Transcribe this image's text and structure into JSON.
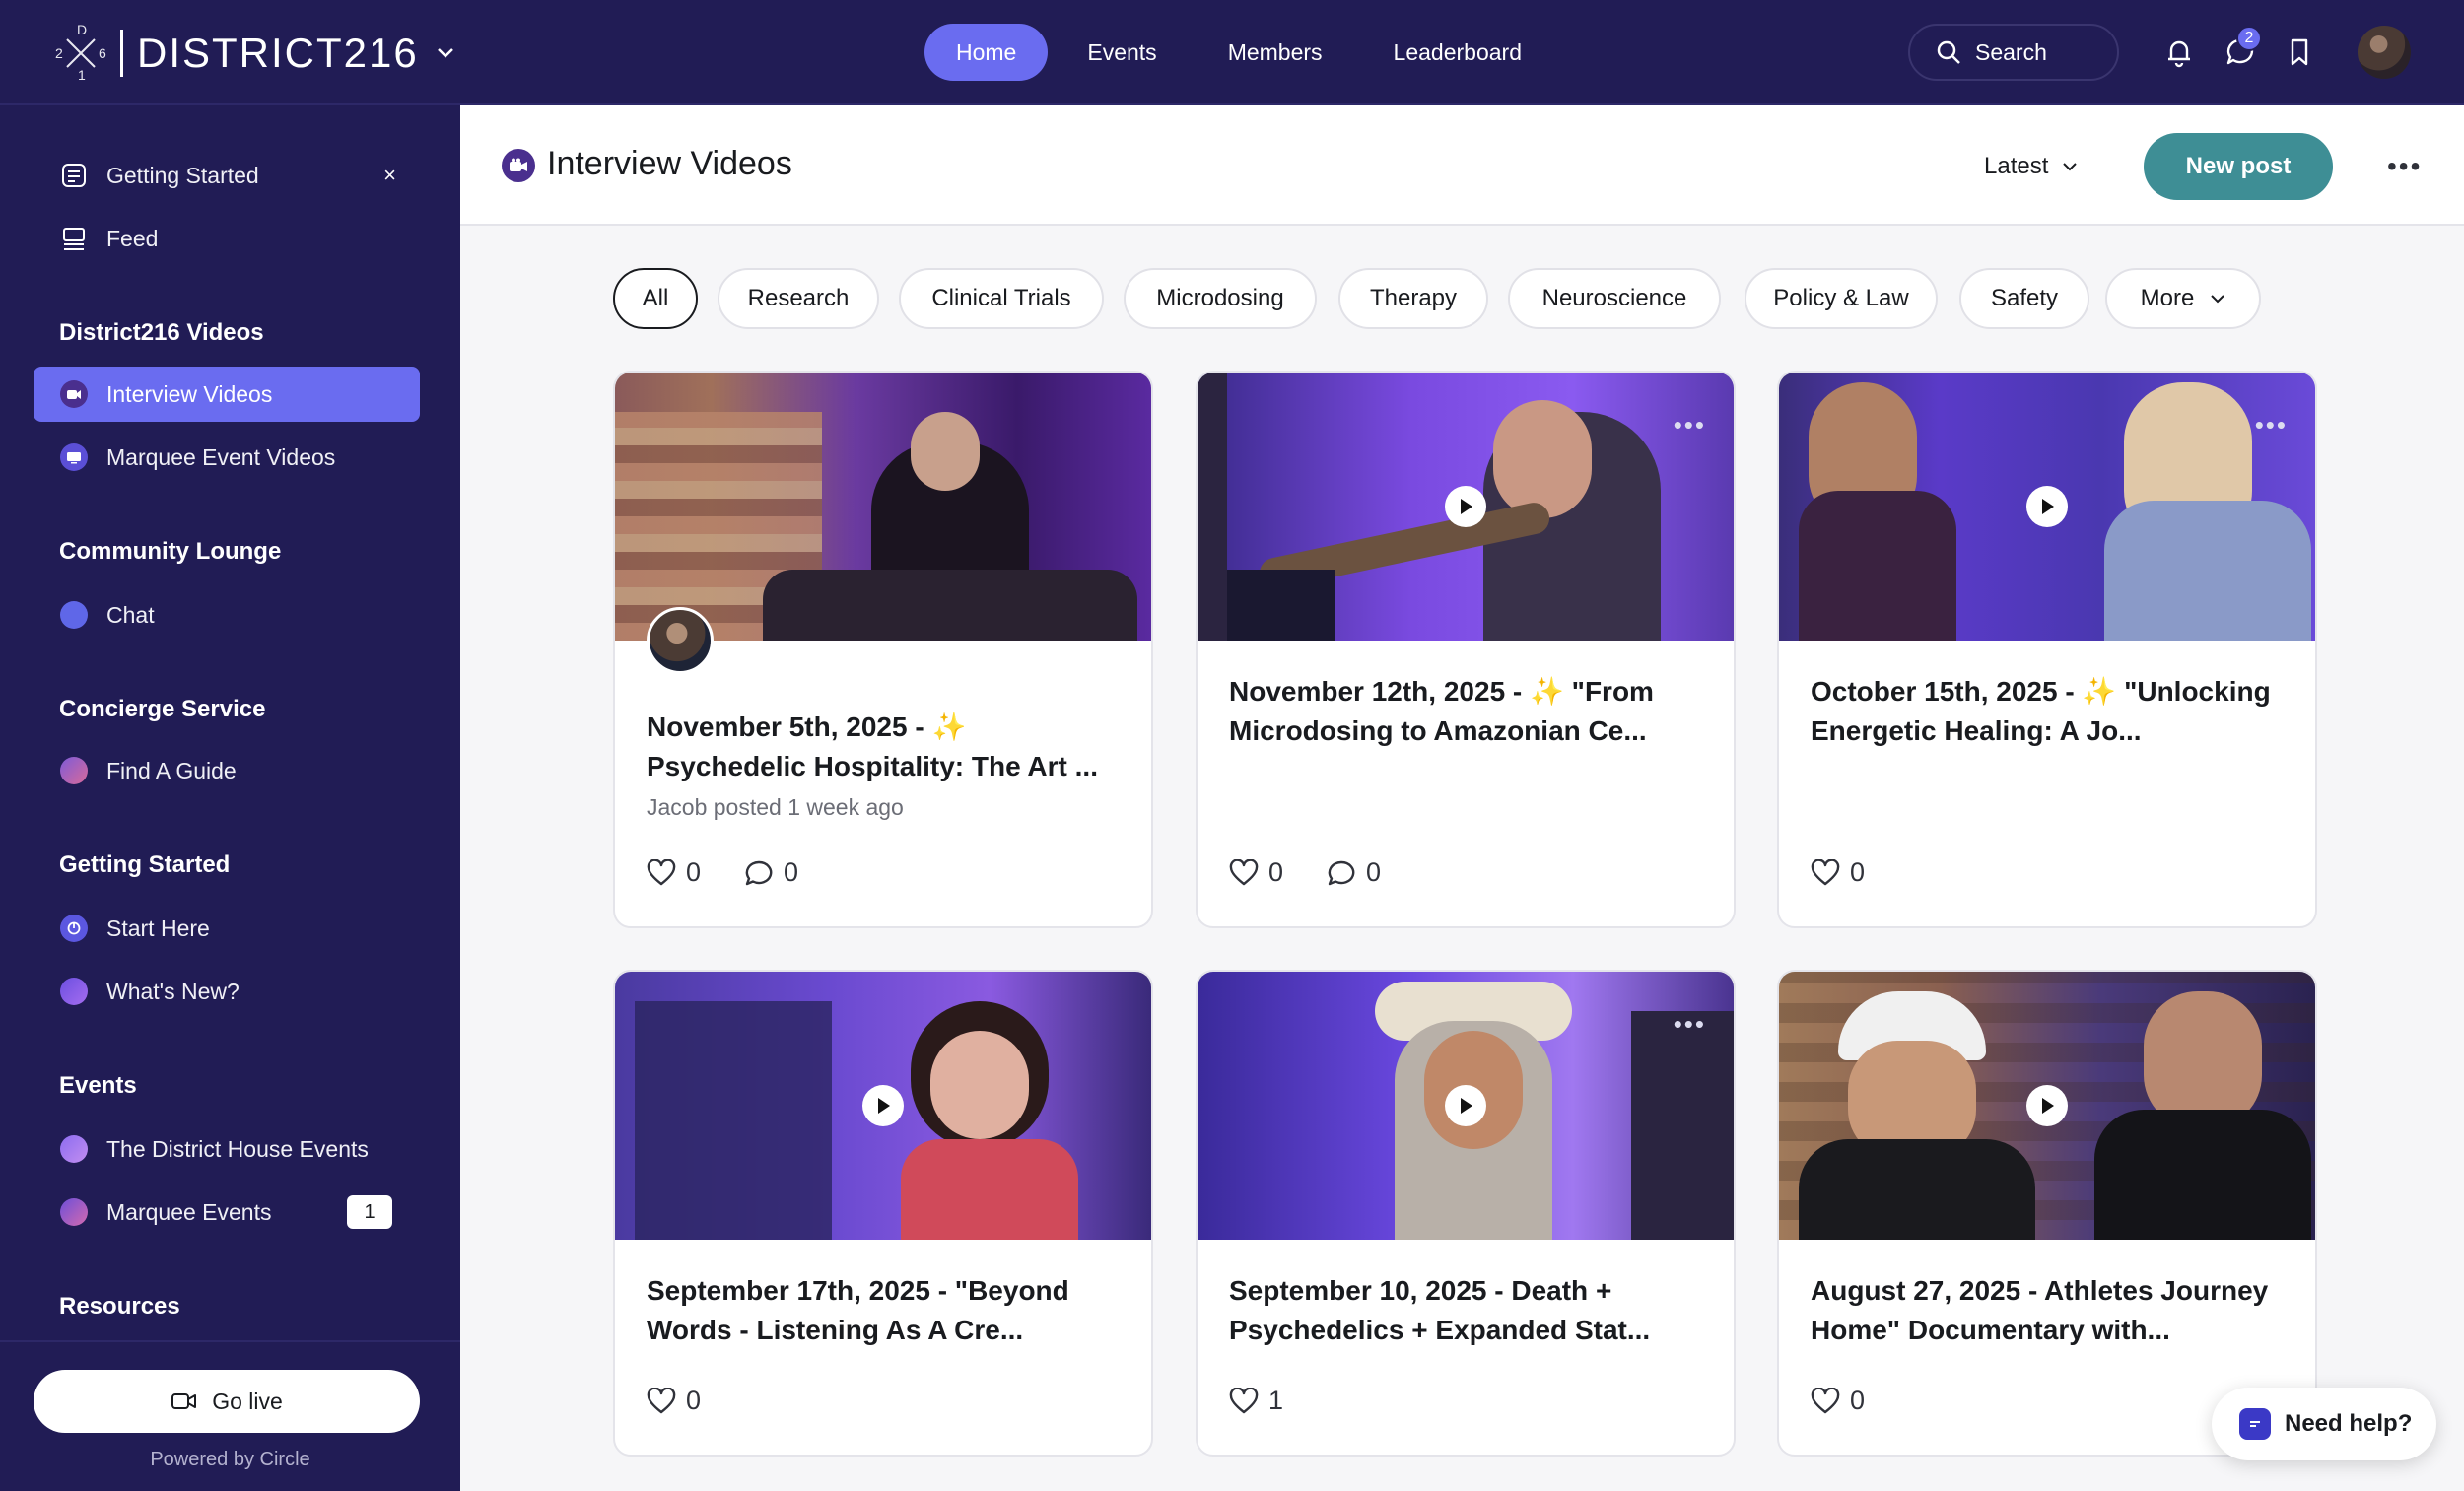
{
  "brand": {
    "name": "DISTRICT216",
    "logo_letters": [
      "D",
      "2",
      "6",
      "1"
    ]
  },
  "nav": {
    "items": [
      {
        "label": "Home",
        "active": true
      },
      {
        "label": "Events",
        "active": false
      },
      {
        "label": "Members",
        "active": false
      },
      {
        "label": "Leaderboard",
        "active": false
      }
    ]
  },
  "search": {
    "label": "Search"
  },
  "notifications": {
    "messages_badge": "2"
  },
  "sidebar": {
    "top_items": [
      {
        "label": "Getting Started",
        "icon": "checklist-icon",
        "close": "×"
      },
      {
        "label": "Feed",
        "icon": "feed-icon"
      }
    ],
    "sections": [
      {
        "heading": "District216 Videos",
        "items": [
          {
            "label": "Interview Videos",
            "active": true
          },
          {
            "label": "Marquee Event Videos"
          }
        ]
      },
      {
        "heading": "Community Lounge",
        "items": [
          {
            "label": "Chat"
          }
        ]
      },
      {
        "heading": "Concierge Service",
        "items": [
          {
            "label": "Find A Guide"
          }
        ]
      },
      {
        "heading": "Getting Started",
        "items": [
          {
            "label": "Start Here"
          },
          {
            "label": "What's New?"
          }
        ]
      },
      {
        "heading": "Events",
        "items": [
          {
            "label": "The District House Events"
          },
          {
            "label": "Marquee Events",
            "count": "1"
          }
        ]
      },
      {
        "heading": "Resources",
        "items": []
      }
    ],
    "go_live": "Go live",
    "powered_by": "Powered by Circle"
  },
  "header": {
    "title": "Interview Videos",
    "sort": "Latest",
    "new_post": "New post"
  },
  "filters": [
    "All",
    "Research",
    "Clinical Trials",
    "Microdosing",
    "Therapy",
    "Neuroscience",
    "Policy & Law",
    "Safety",
    "More"
  ],
  "cards": [
    {
      "line1": "November 5th, 2025 - ✨",
      "line2": "Psychedelic Hospitality: The Art ...",
      "meta": "Jacob posted 1 week ago",
      "likes": "0",
      "comments": "0"
    },
    {
      "line1": "November 12th, 2025 - ✨ \"From",
      "line2": "Microdosing to Amazonian Ce...",
      "likes": "0",
      "comments": "0"
    },
    {
      "line1": "October 15th, 2025 - ✨ \"Unlocking",
      "line2": "Energetic Healing: A Jo...",
      "likes": "0"
    },
    {
      "line1": "September 17th, 2025 - \"Beyond",
      "line2": "Words - Listening As A Cre...",
      "likes": "0"
    },
    {
      "line1": "September 10, 2025 - Death +",
      "line2": "Psychedelics + Expanded Stat...",
      "likes": "1"
    },
    {
      "line1": "August 27, 2025 - Athletes Journey",
      "line2": "Home\" Documentary with...",
      "likes": "0"
    }
  ],
  "help": {
    "label": "Need help?"
  },
  "colors": {
    "nav_bg": "#211c55",
    "accent": "#6a6cf0",
    "new_post": "#3e8e95"
  }
}
